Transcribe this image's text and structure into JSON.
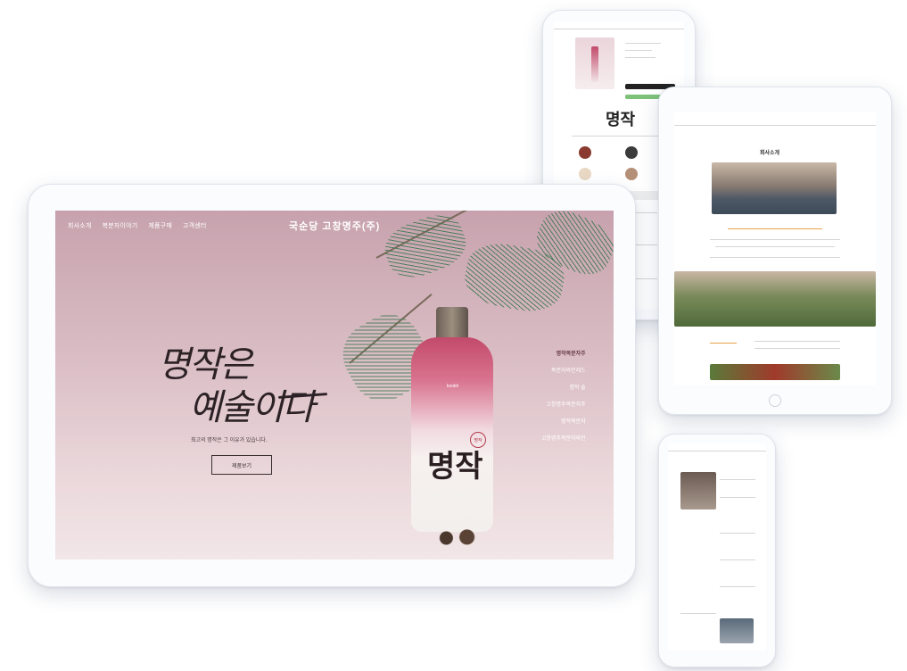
{
  "main_site": {
    "nav": [
      "회사소개",
      "복분자이야기",
      "제품구매",
      "고객센터"
    ],
    "brand": "국순당 고창명주(주)",
    "headline_line1": "명작은",
    "headline_line2": "예술이다",
    "tagline": "최고의 명작은 그 이유가 있습니다.",
    "cta_label": "제품보기",
    "side_menu": [
      "명작복분자주",
      "복분자와인레드",
      "명작 술",
      "고창명주복분자주",
      "명작복분자",
      "고창명주복분자와인"
    ],
    "bottle_label": "명작",
    "bottle_small": "kookh",
    "bottle_seal": "명작"
  },
  "phone_top": {
    "word": "명작"
  },
  "tablet_right": {
    "title": "회사소개"
  },
  "colors": {
    "hero_pink": "#c7a2ae",
    "bottle_red": "#c24a6a",
    "ink": "#2c2226"
  }
}
